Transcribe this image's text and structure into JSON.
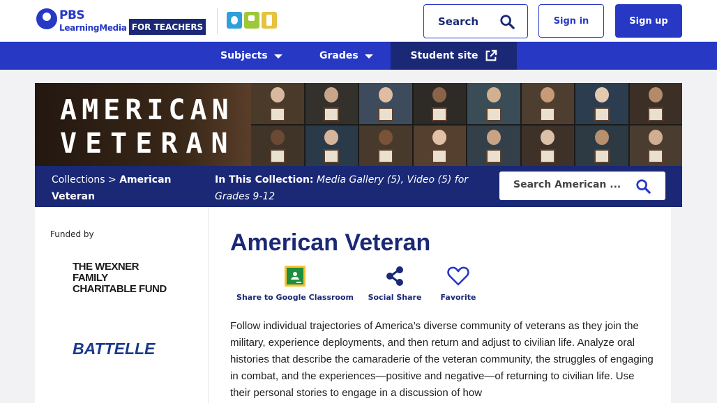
{
  "header": {
    "logo_wordmark": "PBS",
    "logo_sub": "LearningMedia",
    "audience_badge": "FOR TEACHERS",
    "partner_logo": "OPB",
    "search_label": "Search",
    "sign_in": "Sign in",
    "sign_up": "Sign up"
  },
  "nav": {
    "subjects": "Subjects",
    "grades": "Grades",
    "student_site": "Student site"
  },
  "banner": {
    "line1": "AMERICAN",
    "line2": "VETERAN"
  },
  "collection_bar": {
    "crumb_parent": "Collections",
    "crumb_separator": " > ",
    "crumb_current": "American Veteran",
    "in_collection_label": "In This Collection:",
    "in_collection_value": "Media Gallery (5), Video (5) for Grades 9-12",
    "search_placeholder": "Search American ..."
  },
  "sidebar": {
    "funded_by": "Funded by",
    "funder1": "THE WEXNER FAMILY CHARITABLE FUND",
    "funder2": "BATTELLE"
  },
  "main": {
    "title": "American Veteran",
    "actions": {
      "classroom": "Share to Google Classroom",
      "share": "Social Share",
      "favorite": "Favorite"
    },
    "description": "Follow individual trajectories of America’s diverse community of veterans as they join the military, experience deployments, and then return and adjust to civilian life. Analyze oral histories that describe the camaraderie of the veteran community, the struggles of engaging in combat, and the experiences—positive and negative—of returning to civilian life. Use their personal stories to engage in a discussion of how"
  },
  "colors": {
    "pbs_blue": "#2638c4",
    "navy": "#1a2876",
    "classroom_green": "#1e8e3e",
    "classroom_yellow": "#f9c22e"
  }
}
